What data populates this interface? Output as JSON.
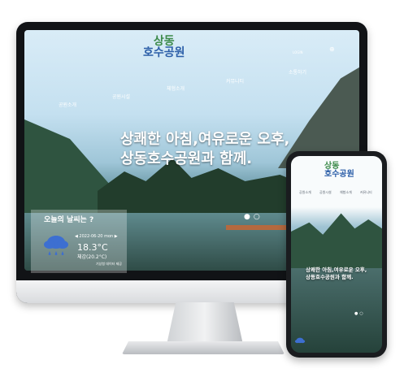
{
  "desktop": {
    "logo": {
      "line1": "상동",
      "line2": "호수공원"
    },
    "nav": [
      "공원소개",
      "공원시설",
      "체험소개",
      "커뮤니티",
      "소통하기"
    ],
    "top_right_login": "LOGIN",
    "hero_line1": "상쾌한 아침,여유로운 오후,",
    "hero_line2": "상동호수공원과 함께.",
    "slider_dots": "●○",
    "weather": {
      "title": "오늘의 날씨는 ?",
      "date": "◀ 2022-06-20 mon ▶",
      "temp": "18.3°C",
      "feels": "체감(20.2°C)",
      "source": "기상청 데이터 제공",
      "icon": "rain-cloud-icon"
    }
  },
  "phone": {
    "logo": {
      "line1": "상동",
      "line2": "호수공원"
    },
    "nav": [
      "공원소개",
      "공원시설",
      "체험소개",
      "커뮤니티"
    ],
    "hero_line1": "상쾌한 아침,여유로운 오후,",
    "hero_line2": "상동호수공원과 함께.",
    "slider_dots": "●○"
  },
  "colors": {
    "logo_blue": "#2b5ea8",
    "logo_green": "#3c8a4a",
    "weather_icon": "#3d6fd1"
  }
}
